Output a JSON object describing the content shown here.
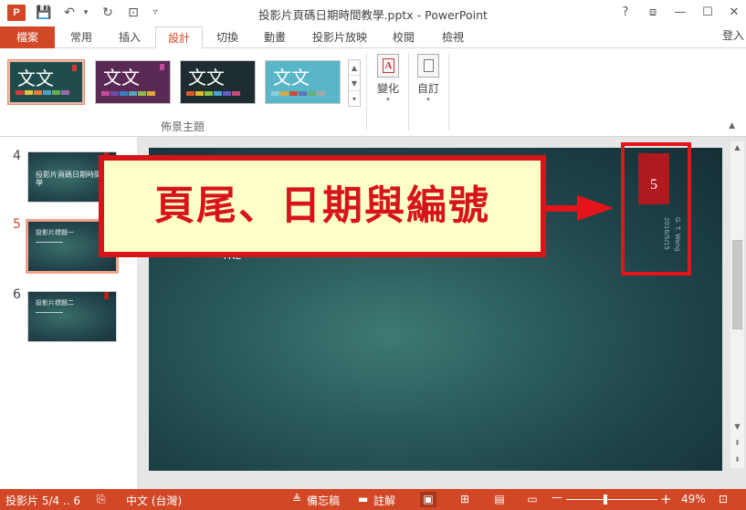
{
  "window": {
    "title": "投影片頁碼日期時間教學.pptx - PowerPoint",
    "app_logo": "P",
    "help": "?",
    "restore": "⧈",
    "minimize": "—",
    "maximize": "☐",
    "close": "✕"
  },
  "quick_access": {
    "save": "💾",
    "undo": "↶",
    "undo_caret": "▾",
    "redo": "↻",
    "present": "⊡",
    "customize": "▿"
  },
  "tabs": [
    "檔案",
    "常用",
    "插入",
    "設計",
    "切換",
    "動畫",
    "投影片放映",
    "校閱",
    "檢視"
  ],
  "signin": "登入",
  "ribbon": {
    "themes": [
      {
        "text": "文文",
        "bg": "#1f4d4b",
        "flag": "#d63a3a",
        "swatches": [
          "#d63a3a",
          "#e6c243",
          "#e77c35",
          "#4f9fcc",
          "#67ad54",
          "#a566b0"
        ],
        "selected": true
      },
      {
        "text": "文文",
        "bg": "#5a2a55",
        "flag": "#c9489d",
        "swatches": [
          "#c9489d",
          "#6b4fa5",
          "#3d7fc4",
          "#52a7b5",
          "#8dbb4b",
          "#d9a93a"
        ],
        "selected": false
      },
      {
        "text": "文文",
        "bg": "#1e2d2f",
        "flag": "",
        "swatches": [
          "#d85a2a",
          "#e4b733",
          "#8cc04a",
          "#4ba3d6",
          "#6a5bc0",
          "#c84b7a"
        ],
        "selected": false
      },
      {
        "text": "文文",
        "bg": "#59b6c9",
        "flag": "",
        "swatches": [
          "#8ed0d9",
          "#d6a94a",
          "#c94d3a",
          "#5679b8",
          "#64b07c",
          "#a7a7a7"
        ],
        "selected": false
      }
    ],
    "gallery_scroll": [
      "▲",
      "▼",
      "▾"
    ],
    "group_label_theme": "佈景主題",
    "variants_label": "變化",
    "customize_label": "自訂",
    "collapse": "▲"
  },
  "slides": [
    {
      "num": "4",
      "title": "投影片頁碼日期時間教學",
      "active": false
    },
    {
      "num": "5",
      "title": "投影片標題一",
      "active": true
    },
    {
      "num": "6",
      "title": "投影片標題二",
      "active": false
    }
  ],
  "slide": {
    "number": "5",
    "author": "G. T. Wang",
    "date": "2016/5/15",
    "partial_text": "TRE"
  },
  "callout": {
    "text": "頁尾、日期與編號"
  },
  "scrollbar": {
    "up": "▲",
    "down": "▼",
    "prev_slide": "⇞",
    "next_slide": "⇟"
  },
  "status": {
    "slide_info": "投影片 5/4 .. 6",
    "language": "中文 (台灣)",
    "notes": "備忘稿",
    "comments": "註解",
    "zoom": "49%",
    "zoom_minus": "—",
    "zoom_plus": "+",
    "zoom_level": 0.49
  },
  "colors": {
    "accent": "#d24726",
    "callout_red": "#d8141b",
    "callout_bg": "#ffffc8",
    "slide_number_box": "#b0191d"
  }
}
